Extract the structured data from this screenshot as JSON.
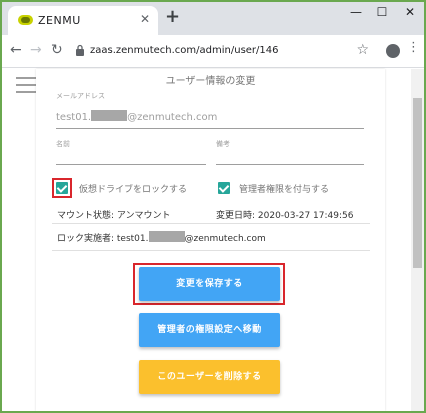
{
  "browser": {
    "tab_title": "ZENMU",
    "tab_close": "✕",
    "new_tab": "+",
    "window_controls": {
      "minimize": "—",
      "maximize": "☐",
      "close": "✕"
    },
    "url": "zaas.zenmutech.com/admin/user/146",
    "nav": {
      "back": "←",
      "forward": "→",
      "reload": "↻"
    },
    "star": "☆",
    "menu": "⋮"
  },
  "page": {
    "heading": "ユーザー情報の変更",
    "email": {
      "label": "メールアドレス",
      "value_prefix": "test01.",
      "value_suffix": "@zenmutech.com"
    },
    "name": {
      "label": "名前",
      "value": ""
    },
    "remarks": {
      "label": "備考",
      "value": ""
    },
    "lock_drive": {
      "label": "仮想ドライブをロックする",
      "checked": true
    },
    "grant_admin": {
      "label": "管理者権限を付与する",
      "checked": true
    },
    "mount_state": "マウント状態: アンマウント",
    "changed_at": "変更日時: 2020-03-27 17:49:56",
    "locker_prefix": "ロック実施者: test01.",
    "locker_suffix": "@zenmutech.com"
  },
  "buttons": {
    "save": "変更を保存する",
    "admin_settings": "管理者の権限設定へ移動",
    "delete_user": "このユーザーを削除する"
  },
  "colors": {
    "primary": "#42a5f5",
    "warning": "#fbc02d",
    "checkbox": "#26a69a",
    "highlight": "#d9262c"
  }
}
